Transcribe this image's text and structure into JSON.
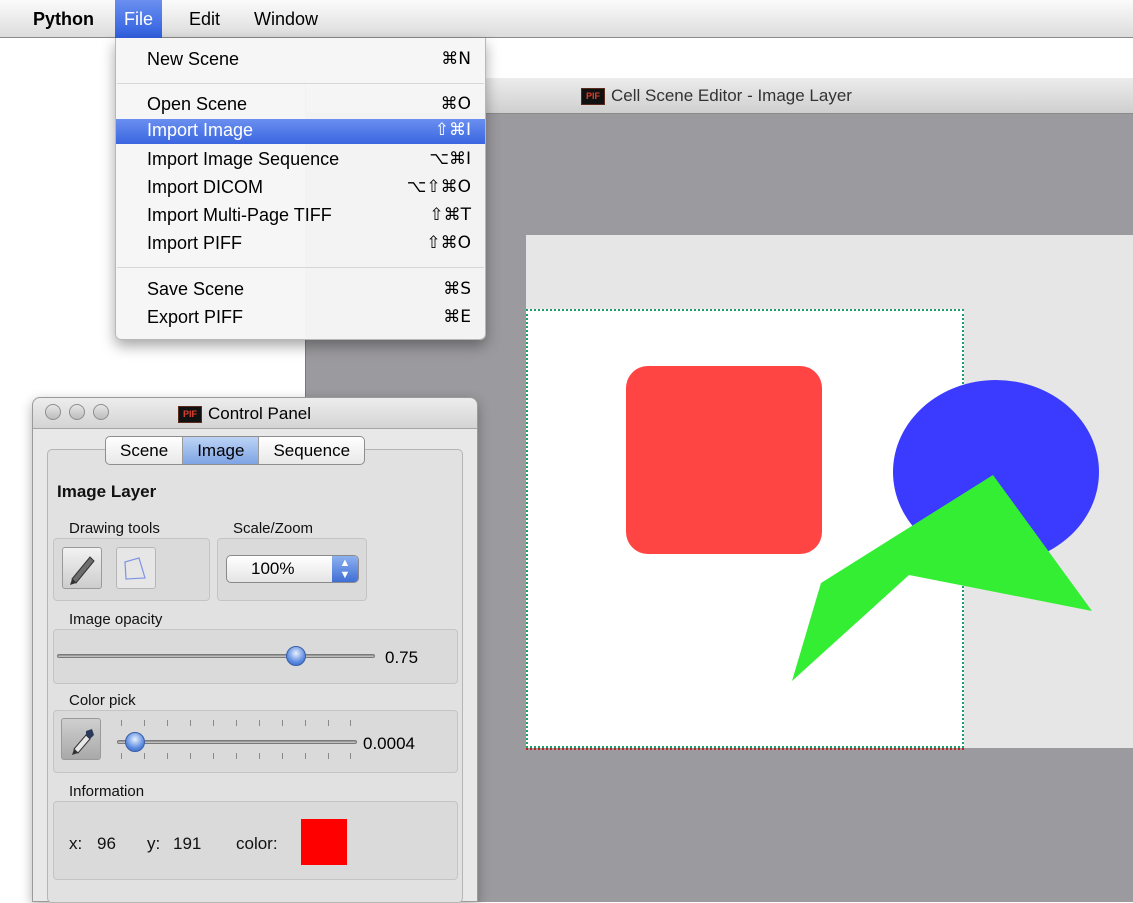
{
  "menubar": {
    "items": [
      "Python",
      "File",
      "Edit",
      "Window"
    ]
  },
  "file_menu": {
    "items": [
      {
        "label": "New Scene",
        "shortcut": "⌘N"
      },
      {
        "label": "Open Scene",
        "shortcut": "⌘O"
      },
      {
        "label": "Import Image",
        "shortcut": "⇧⌘I"
      },
      {
        "label": "Import Image Sequence",
        "shortcut": "⌥⌘I"
      },
      {
        "label": "Import DICOM",
        "shortcut": "⌥⇧⌘O"
      },
      {
        "label": "Import Multi-Page TIFF",
        "shortcut": "⇧⌘T"
      },
      {
        "label": "Import PIFF",
        "shortcut": "⇧⌘O"
      },
      {
        "label": "Save Scene",
        "shortcut": "⌘S"
      },
      {
        "label": "Export PIFF",
        "shortcut": "⌘E"
      }
    ],
    "highlighted": "Import Image"
  },
  "editor": {
    "title": "Cell Scene Editor - Image Layer",
    "logo": "PIF"
  },
  "control_panel": {
    "title": "Control Panel",
    "logo": "PIF",
    "tabs": [
      "Scene",
      "Image",
      "Sequence"
    ],
    "selected_tab": "Image",
    "section_title": "Image Layer",
    "drawing_tools_label": "Drawing tools",
    "scale_zoom_label": "Scale/Zoom",
    "zoom_value": "100%",
    "opacity_label": "Image opacity",
    "opacity_value": "0.75",
    "opacity_fraction": 0.75,
    "color_pick_label": "Color pick",
    "color_pick_value": "0.0004",
    "information_label": "Information",
    "info": {
      "x_label": "x:",
      "x_value": "96",
      "y_label": "y:",
      "y_value": "191",
      "color_label": "color:",
      "color_swatch": "#ff0000"
    }
  },
  "colors": {
    "menu_highlight": "#3a66e0",
    "canvas_red": "#ff4444",
    "canvas_blue": "#3b3bff",
    "canvas_green": "#33ee33"
  }
}
